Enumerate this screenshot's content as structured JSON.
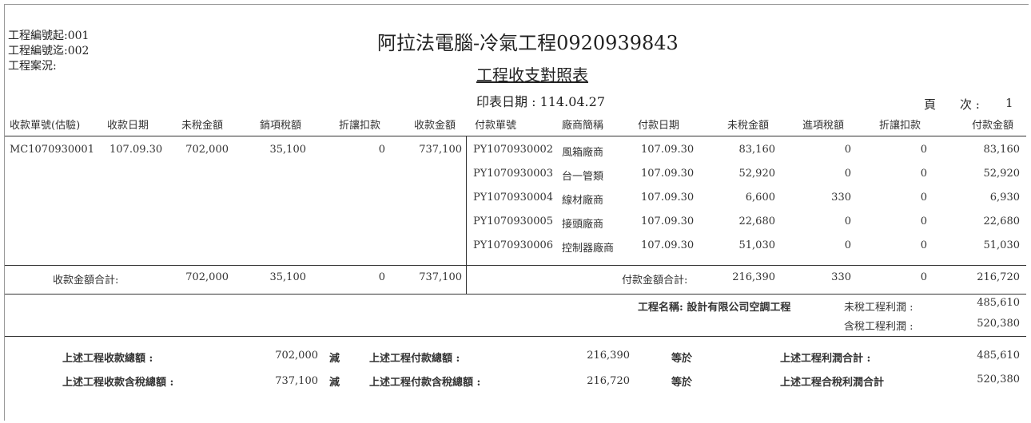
{
  "header": {
    "meta": [
      "工程編號起:001",
      "工程編號迄:002",
      "工程案況:"
    ],
    "company": "阿拉法電腦-冷氣工程0920939843",
    "report_title": "工程收支對照表",
    "print_date": "印表日期 : 114.04.27",
    "page_label": "頁　　次 :",
    "page_number": "1"
  },
  "columns": {
    "receipt": [
      "收款單號(估驗)",
      "收款日期",
      "未稅金額",
      "銷項稅額",
      "折讓扣款",
      "收款金額"
    ],
    "payment": [
      "付款單號",
      "廠商簡稱",
      "付款日期",
      "未稅金額",
      "進項稅額",
      "折讓扣款",
      "付款金額"
    ]
  },
  "receipt_row": {
    "no": "MC1070930001",
    "date": "107.09.30",
    "untaxed": "702,000",
    "tax": "35,100",
    "discount": "0",
    "amount": "737,100"
  },
  "payment_rows": [
    {
      "no": "PY1070930002",
      "vendor": "風箱廠商",
      "date": "107.09.30",
      "untaxed": "83,160",
      "tax": "0",
      "discount": "0",
      "amount": "83,160"
    },
    {
      "no": "PY1070930003",
      "vendor": "台一管類",
      "date": "107.09.30",
      "untaxed": "52,920",
      "tax": "0",
      "discount": "0",
      "amount": "52,920"
    },
    {
      "no": "PY1070930004",
      "vendor": "線材廠商",
      "date": "107.09.30",
      "untaxed": "6,600",
      "tax": "330",
      "discount": "0",
      "amount": "6,930"
    },
    {
      "no": "PY1070930005",
      "vendor": "接頭廠商",
      "date": "107.09.30",
      "untaxed": "22,680",
      "tax": "0",
      "discount": "0",
      "amount": "22,680"
    },
    {
      "no": "PY1070930006",
      "vendor": "控制器廠商",
      "date": "107.09.30",
      "untaxed": "51,030",
      "tax": "0",
      "discount": "0",
      "amount": "51,030"
    }
  ],
  "receipt_total": {
    "label": "收款金額合計:",
    "untaxed": "702,000",
    "tax": "35,100",
    "discount": "0",
    "amount": "737,100"
  },
  "payment_total": {
    "label": "付款金額合計:",
    "untaxed": "216,390",
    "tax": "330",
    "discount": "0",
    "amount": "216,720"
  },
  "project": {
    "name_label": "工程名稱: 設計有限公司空調工程",
    "profit_label": "未稅工程利潤 :",
    "profit_value": "485,610",
    "profit_tax_label": "含稅工程利潤 :",
    "profit_tax_value": "520,380"
  },
  "summary": {
    "row1": {
      "recv_label": "上述工程收款總額 :",
      "recv_value": "702,000",
      "minus": "減",
      "pay_label": "上述工程付款總額 :",
      "pay_value": "216,390",
      "equals": "等於",
      "profit_label": "上述工程利潤合計 :",
      "profit_value": "485,610"
    },
    "row2": {
      "recv_label": "上述工程收款含稅總額 :",
      "recv_value": "737,100",
      "minus": "減",
      "pay_label": "上述工程付款含稅總額 :",
      "pay_value": "216,720",
      "equals": "等於",
      "profit_label": "上述工程合稅利潤合計",
      "profit_value": "520,380"
    }
  },
  "colors": {
    "red": "#d81e1e",
    "text": "#222222",
    "line": "#333333"
  }
}
